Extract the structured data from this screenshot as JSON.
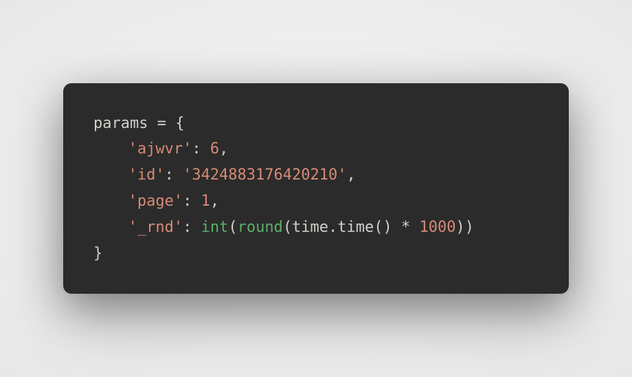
{
  "code": {
    "lines": [
      {
        "indent": false,
        "tokens": [
          {
            "text": "params ",
            "cls": "c-default"
          },
          {
            "text": "=",
            "cls": "c-punct"
          },
          {
            "text": " {",
            "cls": "c-punct"
          }
        ]
      },
      {
        "indent": true,
        "tokens": [
          {
            "text": "'ajwvr'",
            "cls": "c-string"
          },
          {
            "text": ": ",
            "cls": "c-punct"
          },
          {
            "text": "6",
            "cls": "c-number"
          },
          {
            "text": ",",
            "cls": "c-punct"
          }
        ]
      },
      {
        "indent": true,
        "tokens": [
          {
            "text": "'id'",
            "cls": "c-string"
          },
          {
            "text": ": ",
            "cls": "c-punct"
          },
          {
            "text": "'3424883176420210'",
            "cls": "c-string"
          },
          {
            "text": ",",
            "cls": "c-punct"
          }
        ]
      },
      {
        "indent": true,
        "tokens": [
          {
            "text": "'page'",
            "cls": "c-string"
          },
          {
            "text": ": ",
            "cls": "c-punct"
          },
          {
            "text": "1",
            "cls": "c-number"
          },
          {
            "text": ",",
            "cls": "c-punct"
          }
        ]
      },
      {
        "indent": true,
        "tokens": [
          {
            "text": "'_rnd'",
            "cls": "c-string"
          },
          {
            "text": ": ",
            "cls": "c-punct"
          },
          {
            "text": "int",
            "cls": "c-builtin"
          },
          {
            "text": "(",
            "cls": "c-punct"
          },
          {
            "text": "round",
            "cls": "c-builtin"
          },
          {
            "text": "(time.time() ",
            "cls": "c-default"
          },
          {
            "text": "*",
            "cls": "c-punct"
          },
          {
            "text": " ",
            "cls": "c-default"
          },
          {
            "text": "1000",
            "cls": "c-number"
          },
          {
            "text": "))",
            "cls": "c-punct"
          }
        ]
      },
      {
        "indent": false,
        "tokens": [
          {
            "text": "}",
            "cls": "c-punct"
          }
        ]
      }
    ]
  }
}
